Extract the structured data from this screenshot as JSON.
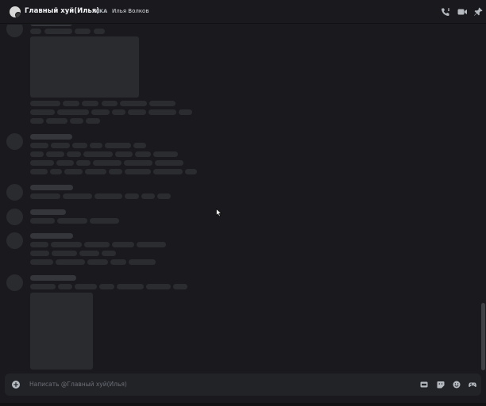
{
  "header": {
    "title": "Главный хуй(Илья)",
    "aka_label": "AKA",
    "aka_name": "Илья Волков",
    "actions": [
      "phone-icon",
      "video-icon",
      "pin-icon"
    ]
  },
  "composer": {
    "placeholder": "Написать @Главный хуй(Илья)",
    "actions": [
      "gif-icon",
      "sticker-icon",
      "emoji-icon",
      "gamepad-icon"
    ]
  },
  "colors": {
    "background": "#1a1a1e",
    "skeleton": "#2b2c30",
    "composer": "#222327"
  }
}
